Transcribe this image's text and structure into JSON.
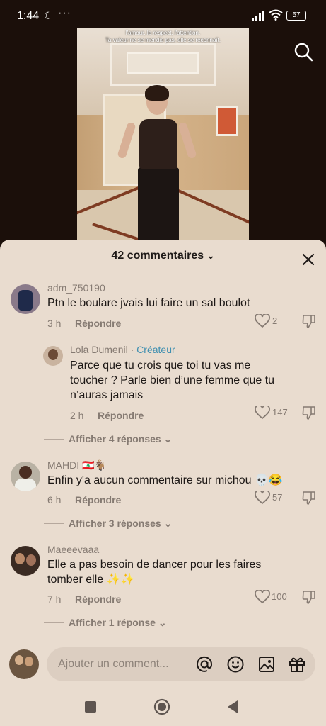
{
  "status_bar": {
    "time": "1:44",
    "battery": "57",
    "moon_icon": "moon-icon",
    "dots": "···"
  },
  "video": {
    "caption_line1": "l'amour, le respect, l'attention.",
    "caption_line2": "Ta valeur ne se mendie pas, elle se reconnaît."
  },
  "sheet": {
    "title": "42 commentaires",
    "chevron": "⌄"
  },
  "comments": [
    {
      "username": "adm_750190",
      "text": "Ptn le boulare jvais lui faire un sal boulot",
      "time": "3 h",
      "reply_label": "Répondre",
      "likes": "2"
    },
    {
      "username": "Lola Dumenil",
      "badge_sep": "·",
      "badge": "Créateur",
      "text_line1": "Parce que tu crois que toi tu vas me",
      "text_line2": "toucher ? Parle bien d’une femme que tu",
      "text_line3": "n’auras jamais",
      "time": "2 h",
      "reply_label": "Répondre",
      "likes": "147",
      "more_replies": "Afficher 4 réponses"
    },
    {
      "username": "MAHDI 🇱🇧🐐",
      "text": "Enfin y'a aucun commentaire sur michou 💀😂",
      "time": "6 h",
      "reply_label": "Répondre",
      "likes": "57",
      "more_replies": "Afficher 3 réponses"
    },
    {
      "username": "Maeeevaaa",
      "text_line1": "Elle a pas besoin de dancer pour les faires",
      "text_line2": "tomber elle ✨✨",
      "time": "7 h",
      "reply_label": "Répondre",
      "likes": "100",
      "more_replies": "Afficher 1 réponse"
    }
  ],
  "input": {
    "placeholder": "Ajouter un comment..."
  },
  "colors": {
    "sheet_bg": "#e9dccf",
    "creator": "#3f8fb0",
    "text": "#1d1816",
    "muted": "#857a72"
  }
}
